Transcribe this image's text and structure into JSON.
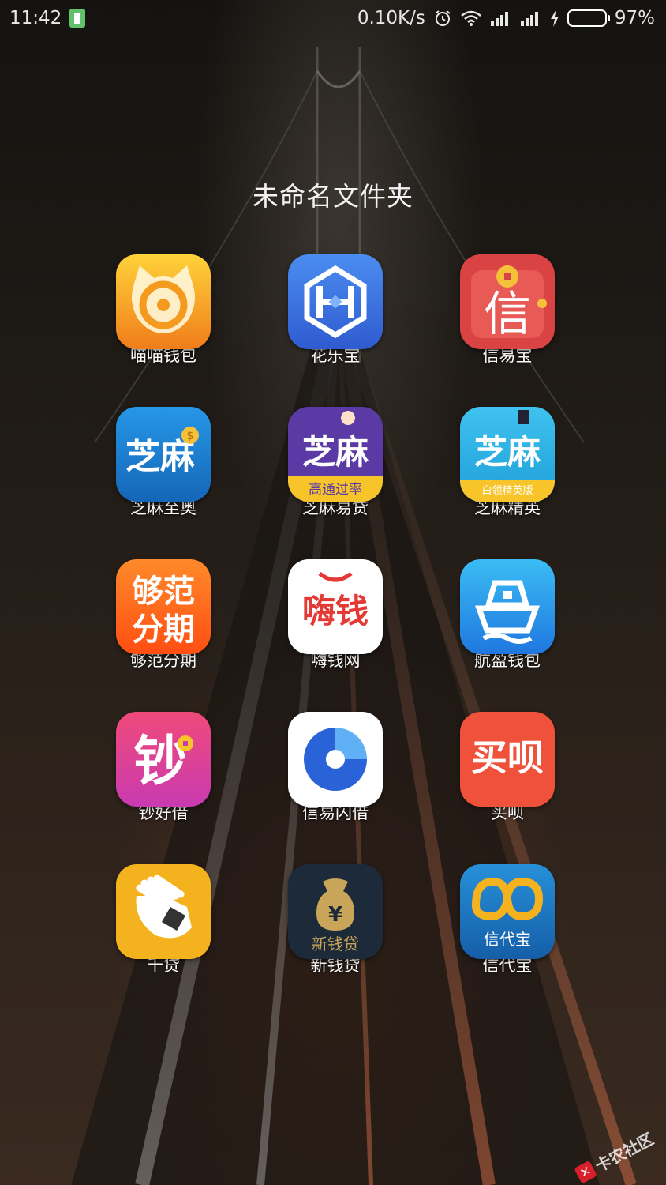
{
  "status_bar": {
    "time": "11:42",
    "network_speed": "0.10K/s",
    "battery_percent": "97%",
    "icons": [
      "battery-saver-icon",
      "alarm-icon",
      "wifi-icon",
      "signal-icon",
      "signal-icon",
      "charging-icon",
      "battery-icon"
    ]
  },
  "folder": {
    "title": "未命名文件夹",
    "apps": [
      {
        "label": "喵喵钱包",
        "icon": "cat-wallet-icon",
        "color": "#f7a21b"
      },
      {
        "label": "花乐宝",
        "icon": "hualebao-icon",
        "color": "#3f6fe0"
      },
      {
        "label": "信易宝",
        "icon": "xinyibao-icon",
        "color": "#d94343",
        "icon_text": "信"
      },
      {
        "label": "芝麻至奥",
        "icon": "zhima-zhiao-icon",
        "color": "#1b7fd3",
        "icon_text": "芝麻"
      },
      {
        "label": "芝麻易贷",
        "icon": "zhima-yidai-icon",
        "color": "#5b3aa5",
        "icon_text": "芝麻",
        "icon_subtext": "高通过率"
      },
      {
        "label": "芝麻精英",
        "icon": "zhima-jingying-icon",
        "color": "#2bb4e8",
        "icon_text": "芝麻",
        "icon_subtext": "白领精英版"
      },
      {
        "label": "够范分期",
        "icon": "goufan-icon",
        "color": "#ff6a1a",
        "icon_text": "够范分期"
      },
      {
        "label": "嗨钱网",
        "icon": "haiqian-icon",
        "color": "#ffffff",
        "icon_text": "嗨钱"
      },
      {
        "label": "航盈钱包",
        "icon": "ship-icon",
        "color": "#2a8fe8"
      },
      {
        "label": "钞好借",
        "icon": "chaohaojie-icon",
        "color": "#e23d8f",
        "icon_text": "钞"
      },
      {
        "label": "信易闪借",
        "icon": "xinyi-shanjie-icon",
        "color": "#ffffff"
      },
      {
        "label": "买呗",
        "icon": "maibei-icon",
        "color": "#f0513a",
        "icon_text": "买呗"
      },
      {
        "label": "千贷",
        "icon": "hand-coin-icon",
        "color": "#f5b21f"
      },
      {
        "label": "新钱贷",
        "icon": "money-bag-icon",
        "color": "#1c2a3a",
        "icon_text": "新钱贷"
      },
      {
        "label": "信代宝",
        "icon": "xindaibao-icon",
        "color": "#1b78c4",
        "icon_text": "信代宝"
      }
    ]
  },
  "watermark": {
    "text": "卡农社区"
  }
}
